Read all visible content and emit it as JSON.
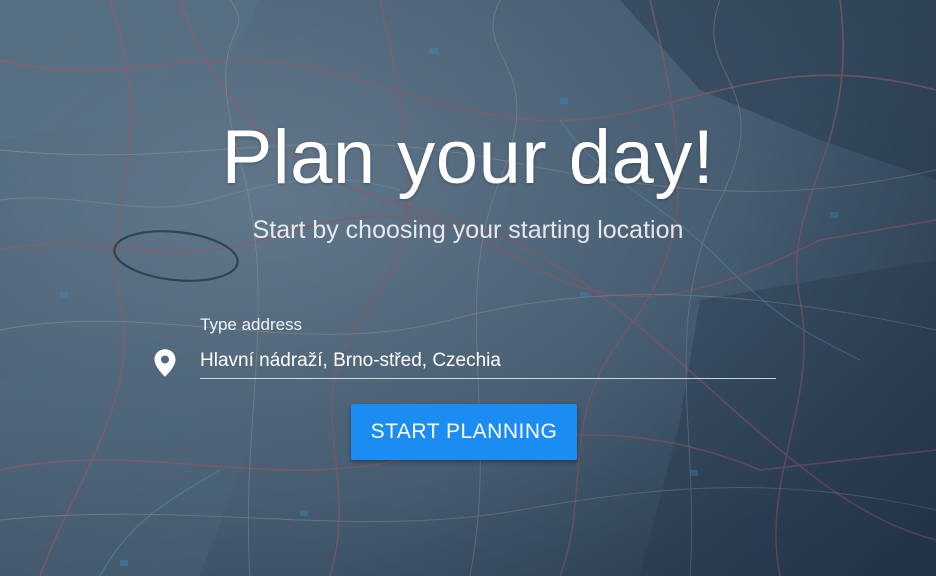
{
  "hero": {
    "title": "Plan your day!",
    "subtitle": "Start by choosing your starting location"
  },
  "address": {
    "label": "Type address",
    "value": "Hlavní nádraží, Brno-střed, Czechia",
    "icon": "location-pin-icon"
  },
  "actions": {
    "start_label": "START PLANNING"
  },
  "colors": {
    "primary": "#1a8cf2",
    "background": "#4a5f72"
  }
}
